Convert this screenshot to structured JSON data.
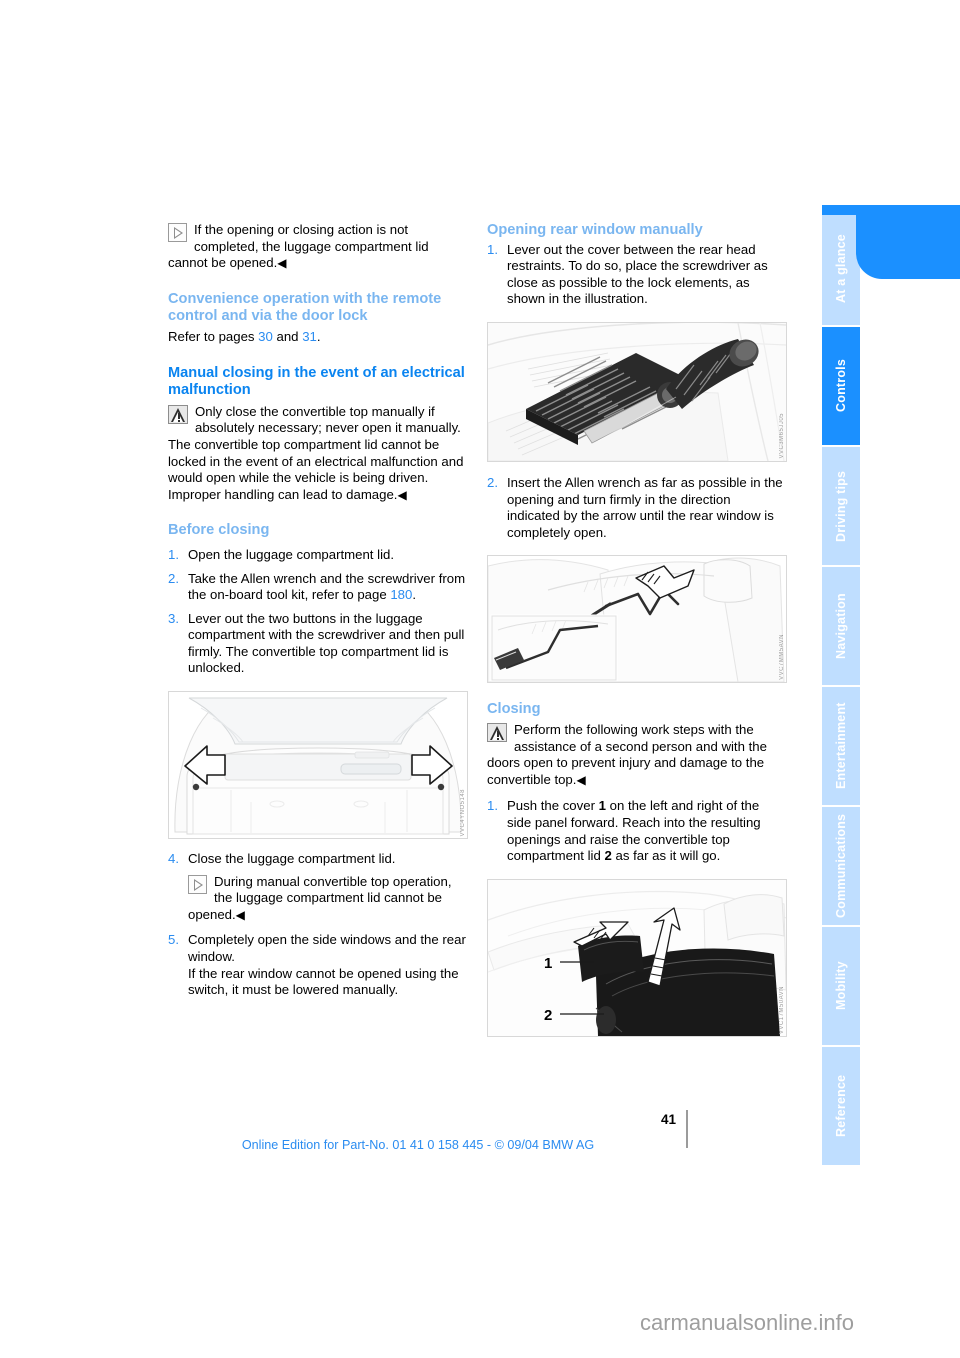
{
  "document": {
    "page_number": "41",
    "footer_line": "Online Edition for Part-No. 01 41 0 158 445 - © 09/04 BMW AG",
    "watermark": "carmanualsonline.info"
  },
  "tabs": [
    {
      "label": "At a glance",
      "active": false
    },
    {
      "label": "Controls",
      "active": true
    },
    {
      "label": "Driving tips",
      "active": false
    },
    {
      "label": "Navigation",
      "active": false
    },
    {
      "label": "Entertainment",
      "active": false
    },
    {
      "label": "Communications",
      "active": false
    },
    {
      "label": "Mobility",
      "active": false
    },
    {
      "label": "Reference",
      "active": false
    }
  ],
  "colors": {
    "accent_blue": "#1b90ff",
    "heading_blue": "#0a84f0",
    "heading_blue_light": "#7ab6f0",
    "tab_inactive": "#bfdeff",
    "link_blue": "#2b8cf0"
  },
  "left_column": {
    "note_top": {
      "icon": "info-icon",
      "text": "If the opening or closing action is not completed, the luggage compartment lid cannot be opened.",
      "end_mark": "◀"
    },
    "heading_convenience": "Convenience operation with the remote control and via the door lock",
    "refer_text_pre": "Refer to pages ",
    "refer_page_1": "30",
    "refer_text_mid": " and ",
    "refer_page_2": "31",
    "refer_text_post": ".",
    "heading_manual_closing": "Manual closing in the event of an electrical malfunction",
    "warning": {
      "icon": "warning-icon",
      "text": "Only close the convertible top manually if absolutely necessary; never open it manually. The convertible top compartment lid cannot be locked in the event of an electrical malfunction and would open while the vehicle is being driven.",
      "text_line2": "Improper handling can lead to damage.",
      "end_mark": "◀"
    },
    "heading_before_closing": "Before closing",
    "steps": [
      {
        "num": "1.",
        "text": "Open the luggage compartment lid."
      },
      {
        "num": "2.",
        "text_pre": "Take the Allen wrench and the screwdriver from the on-board tool kit, refer to page ",
        "page_ref": "180",
        "text_post": "."
      },
      {
        "num": "3.",
        "text": "Lever out the two buttons in the luggage compartment with the screwdriver and then pull firmly. The convertible top compartment lid is unlocked."
      },
      {
        "num": "4.",
        "text": "Close the luggage compartment lid."
      },
      {
        "num": "5.",
        "text": "Completely open the side windows and the rear window.",
        "text2": "If the rear window cannot be opened using the switch, it must be lowered manually."
      }
    ],
    "note_step4": {
      "icon": "info-icon",
      "text": "During manual convertible top operation, the luggage compartment lid cannot be opened.",
      "end_mark": "◀"
    },
    "figure_trunk": {
      "name": "luggage-compartment-illustration",
      "code": "VVC4YNO5148"
    }
  },
  "right_column": {
    "heading_opening_rear_window": "Opening rear window manually",
    "steps": [
      {
        "num": "1.",
        "text": "Lever out the cover between the rear head restraints. To do so, place the screwdriver as close as possible to the lock elements, as shown in the illustration."
      },
      {
        "num": "2.",
        "text": "Insert the Allen wrench as far as possible in the opening and turn firmly in the direction indicated by the arrow until the rear window is completely open."
      }
    ],
    "figure_screwdriver": {
      "name": "screwdriver-cover-illustration",
      "code": "VVC3M65JJ05"
    },
    "figure_allen": {
      "name": "allen-wrench-illustration",
      "code": "VVC7MM5AVN"
    },
    "heading_closing": "Closing",
    "warning": {
      "icon": "warning-icon",
      "text": "Perform the following work steps with the assistance of a second person and with the doors open to prevent injury and damage to the convertible top.",
      "end_mark": "◀"
    },
    "closing_steps": [
      {
        "num": "1.",
        "text_1": "Push the cover ",
        "bold_1": "1",
        "text_2": " on the left and right of the side panel forward. Reach into the resulting openings and raise the convertible top compartment lid ",
        "bold_2": "2",
        "text_3": " as far as it will go."
      }
    ],
    "figure_cover": {
      "name": "convertible-top-cover-illustration",
      "code": "VVC17M50AVN",
      "label_1": "1",
      "label_2": "2"
    }
  }
}
